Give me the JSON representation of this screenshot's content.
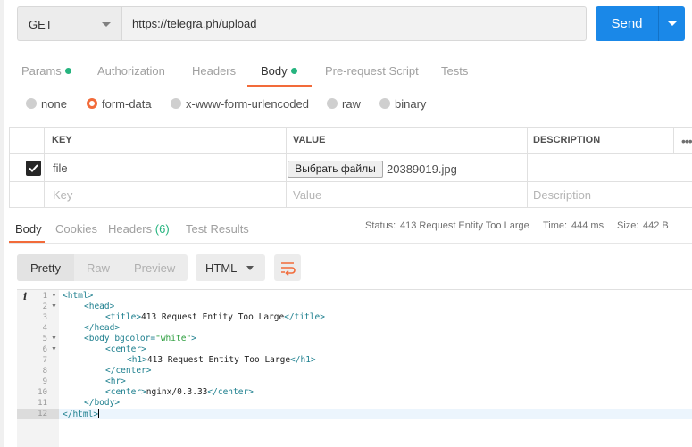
{
  "request": {
    "method": "GET",
    "url": "https://telegra.ph/upload",
    "send_label": "Send"
  },
  "request_tabs": [
    {
      "label": "Params",
      "dot": true
    },
    {
      "label": "Authorization",
      "dot": false
    },
    {
      "label": "Headers",
      "dot": false
    },
    {
      "label": "Body",
      "dot": true,
      "active": true
    },
    {
      "label": "Pre-request Script",
      "dot": false
    },
    {
      "label": "Tests",
      "dot": false
    }
  ],
  "body_modes": [
    {
      "label": "none",
      "selected": false
    },
    {
      "label": "form-data",
      "selected": true
    },
    {
      "label": "x-www-form-urlencoded",
      "selected": false
    },
    {
      "label": "raw",
      "selected": false
    },
    {
      "label": "binary",
      "selected": false
    }
  ],
  "params_table": {
    "headers": [
      "KEY",
      "VALUE",
      "DESCRIPTION"
    ],
    "rows": [
      {
        "checked": true,
        "key": "file",
        "file_button": "Выбрать файлы",
        "file_name": "20389019.jpg",
        "description": ""
      }
    ],
    "placeholders": {
      "key": "Key",
      "value": "Value",
      "description": "Description"
    }
  },
  "response_tabs": [
    {
      "label": "Body",
      "active": true
    },
    {
      "label": "Cookies"
    },
    {
      "label": "Headers",
      "count": "(6)"
    },
    {
      "label": "Test Results"
    }
  ],
  "response_meta": {
    "status_label": "Status:",
    "status_value": "413 Request Entity Too Large",
    "time_label": "Time:",
    "time_value": "444 ms",
    "size_label": "Size:",
    "size_value": "442 B"
  },
  "view_modes": [
    "Pretty",
    "Raw",
    "Preview"
  ],
  "format": "HTML",
  "colors": {
    "accent": "#f26b3a",
    "primary": "#1a88e8",
    "success": "#26b47f"
  },
  "code_lines": [
    {
      "n": "1",
      "fold": true
    },
    {
      "n": "2",
      "fold": true
    },
    {
      "n": "3",
      "fold": false
    },
    {
      "n": "4",
      "fold": false
    },
    {
      "n": "5",
      "fold": true
    },
    {
      "n": "6",
      "fold": true
    },
    {
      "n": "7",
      "fold": false
    },
    {
      "n": "8",
      "fold": false
    },
    {
      "n": "9",
      "fold": false
    },
    {
      "n": "10",
      "fold": false
    },
    {
      "n": "11",
      "fold": false
    },
    {
      "n": "12",
      "fold": false
    }
  ],
  "code": {
    "l1_open": "<html>",
    "l2_open": "<head>",
    "l3_open": "<title>",
    "l3_text": "413 Request Entity Too Large",
    "l3_close": "</title>",
    "l4_close": "</head>",
    "l5_open": "<body",
    "l5_attr": " bgcolor=",
    "l5_val": "\"white\"",
    "l5_end": ">",
    "l6_open": "<center>",
    "l7_open": "<h1>",
    "l7_text": "413 Request Entity Too Large",
    "l7_close": "</h1>",
    "l8_close": "</center>",
    "l9_tag": "<hr>",
    "l10_open": "<center>",
    "l10_text": "nginx/0.3.33",
    "l10_close": "</center>",
    "l11_close": "</body>",
    "l12_close": "</html>"
  }
}
